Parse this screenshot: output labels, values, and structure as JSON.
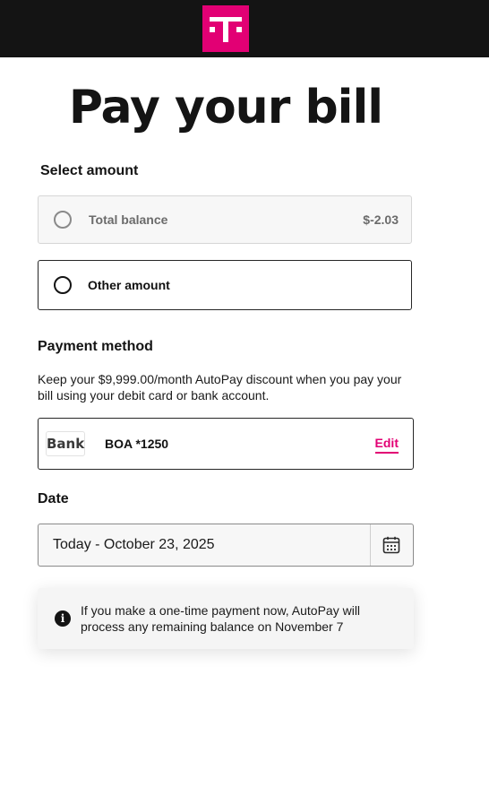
{
  "header": {
    "logo_icon": "t-mobile-logo-icon",
    "brand_color": "#e20074"
  },
  "page": {
    "title": "Pay your bill"
  },
  "amount": {
    "label": "Select amount",
    "options": [
      {
        "label": "Total balance",
        "value": "$-2.03",
        "selected": false
      },
      {
        "label": "Other amount",
        "selected": false
      }
    ]
  },
  "payment": {
    "label": "Payment method",
    "description": "Keep your $9,999.00/month AutoPay discount when you pay your bill using your debit card or bank account.",
    "method": {
      "logo_text": "Bank",
      "name": "BOA *1250",
      "edit_label": "Edit"
    }
  },
  "date": {
    "label": "Date",
    "value": "Today - October 23, 2025",
    "calendar_icon": "calendar-icon"
  },
  "notice": {
    "icon": "info-icon",
    "text": "If you make a one-time payment now, AutoPay will process any remaining balance on November 7"
  }
}
